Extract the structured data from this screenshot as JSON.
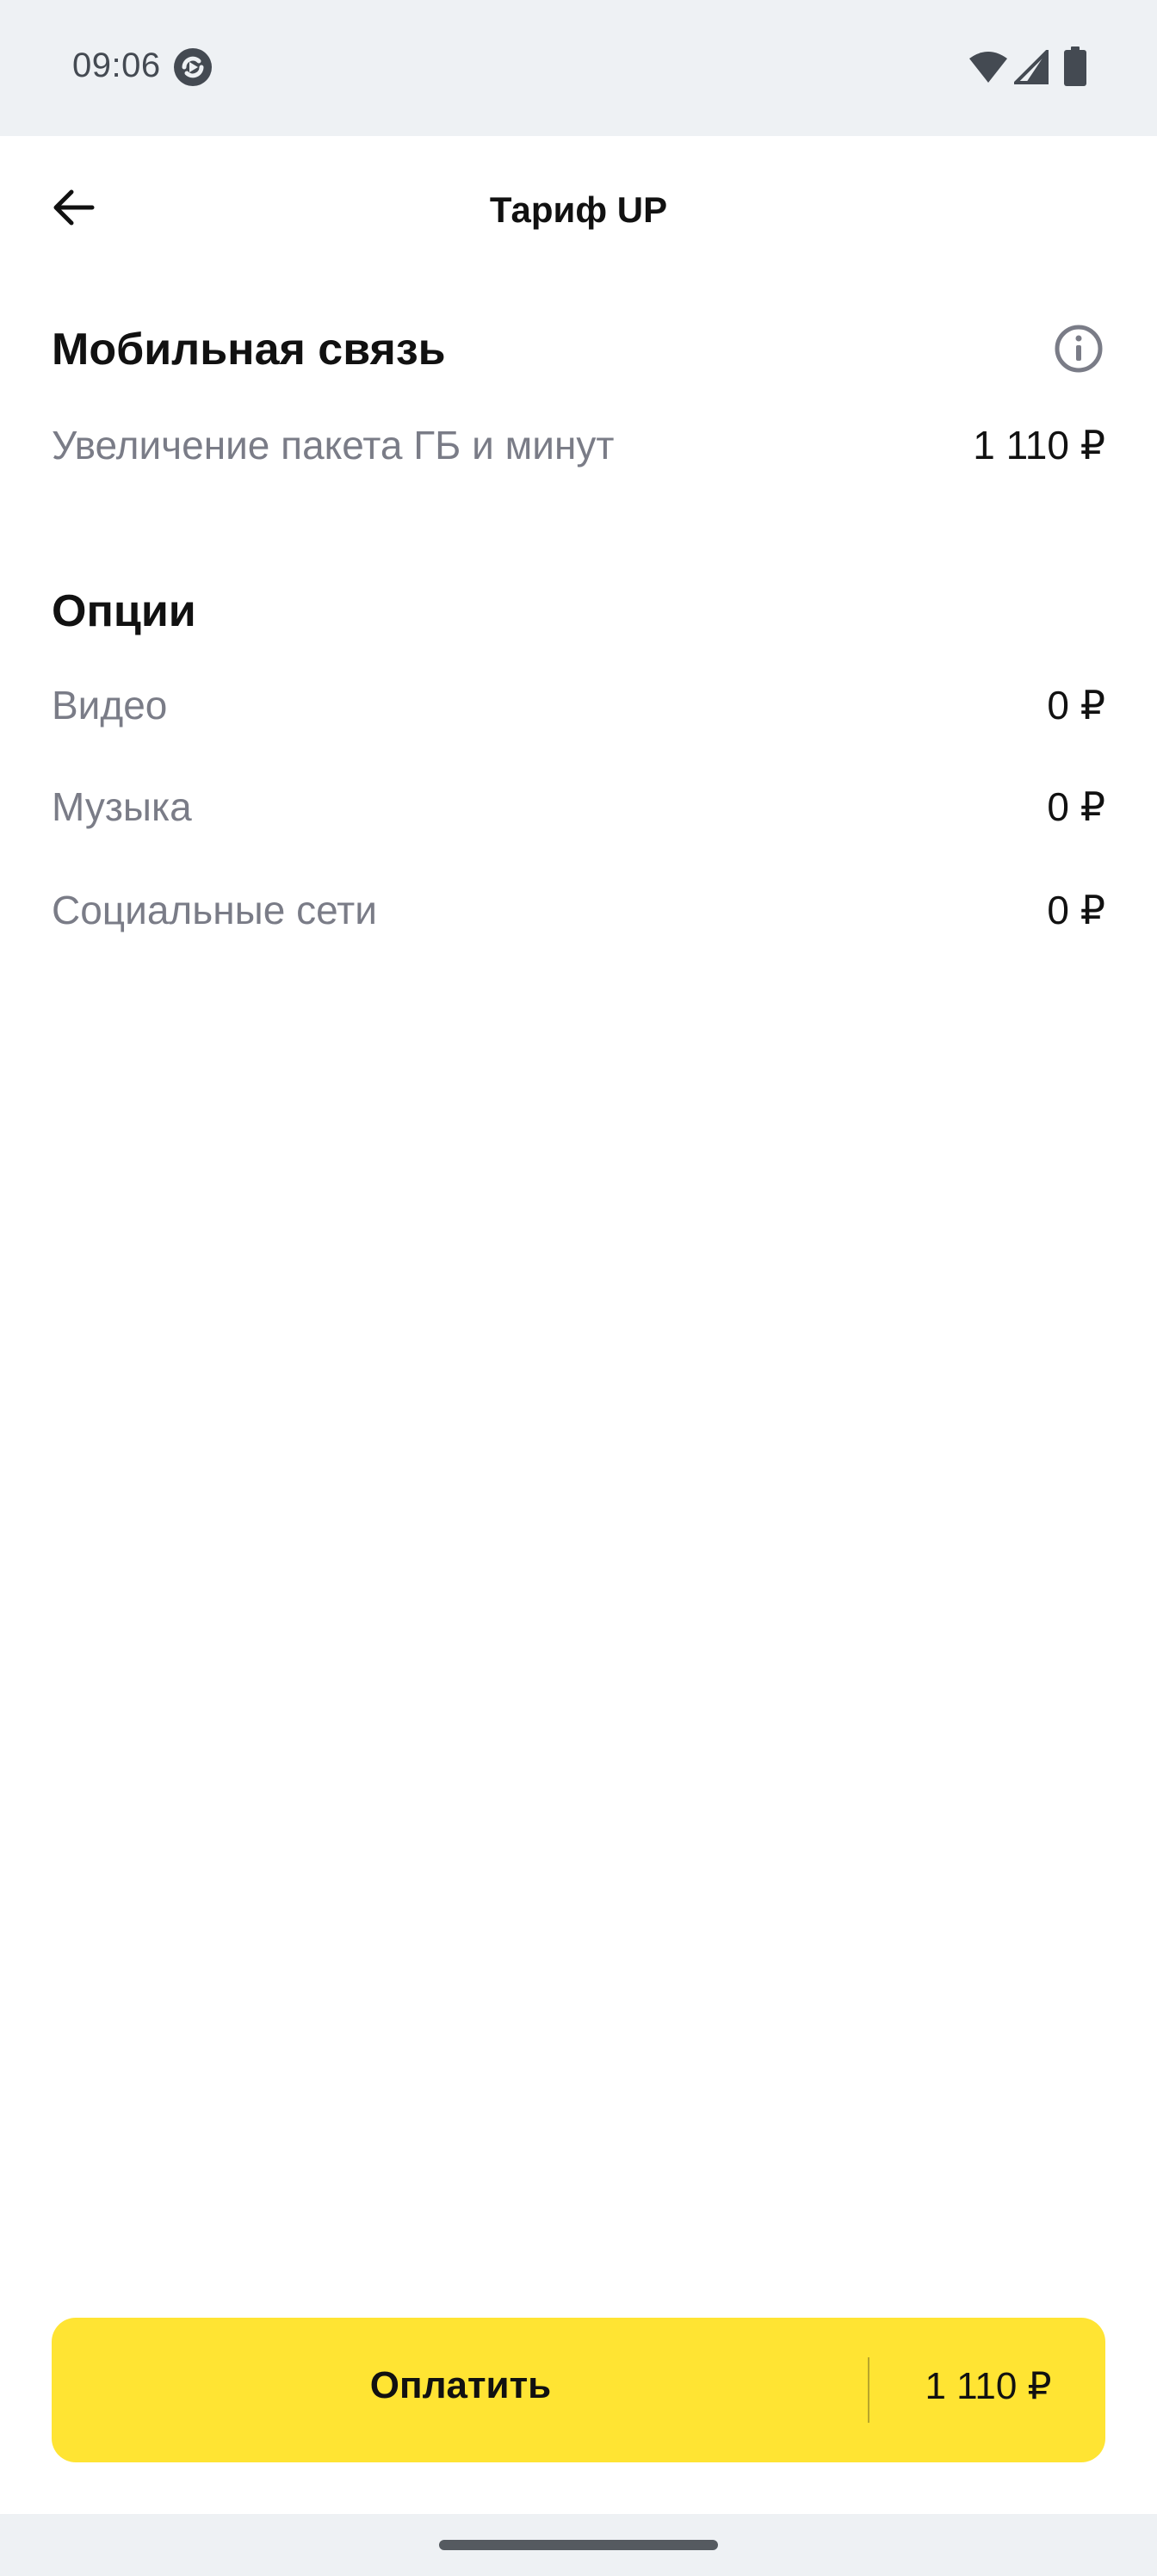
{
  "status_bar": {
    "time": "09:06",
    "icons": [
      "app-notification-icon",
      "wifi-icon",
      "signal-icon",
      "battery-icon"
    ]
  },
  "header": {
    "title": "Тариф UP",
    "back_icon": "arrow-left-icon"
  },
  "mobile_section": {
    "title": "Мобильная связь",
    "info_icon": "info-icon",
    "items": [
      {
        "label": "Увеличение пакета ГБ и минут",
        "value": "1 110 ₽"
      }
    ]
  },
  "options_section": {
    "title": "Опции",
    "items": [
      {
        "label": "Видео",
        "value": "0 ₽"
      },
      {
        "label": "Музыка",
        "value": "0 ₽"
      },
      {
        "label": "Социальные сети",
        "value": "0 ₽"
      }
    ]
  },
  "pay_button": {
    "label": "Оплатить",
    "amount": "1 110 ₽",
    "color": "#ffe433"
  }
}
